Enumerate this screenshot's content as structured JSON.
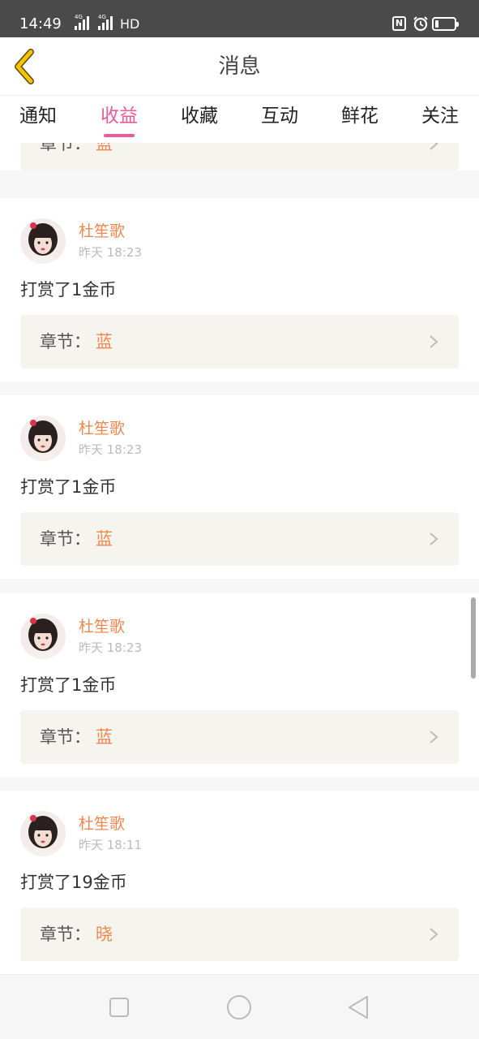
{
  "status_bar": {
    "time": "14:49",
    "network_1": "4G",
    "network_2": "4G",
    "hd": "HD",
    "battery_level": 0.2,
    "icons": [
      "signal-icon",
      "signal-icon",
      "nfc-icon",
      "alarm-icon",
      "battery-icon"
    ]
  },
  "header": {
    "title": "消息",
    "back_icon": "back-arrow-icon",
    "back_color": "#f5c400"
  },
  "tabs": [
    {
      "label": "通知",
      "active": false
    },
    {
      "label": "收益",
      "active": true
    },
    {
      "label": "收藏",
      "active": false
    },
    {
      "label": "互动",
      "active": false
    },
    {
      "label": "鲜花",
      "active": false
    },
    {
      "label": "关注",
      "active": false
    }
  ],
  "colors": {
    "accent": "#e85b98",
    "name": "#f0874f",
    "chapter_bg": "#f5f4ee"
  },
  "chapter_label": "章节：",
  "partial_card": {
    "chapter_label": "章节：",
    "chapter_value": "蓝"
  },
  "messages": [
    {
      "user": "杜笙歌",
      "time": "昨天 18:23",
      "text": "打赏了1金币",
      "chapter": "蓝"
    },
    {
      "user": "杜笙歌",
      "time": "昨天 18:23",
      "text": "打赏了1金币",
      "chapter": "蓝"
    },
    {
      "user": "杜笙歌",
      "time": "昨天 18:23",
      "text": "打赏了1金币",
      "chapter": "蓝"
    },
    {
      "user": "杜笙歌",
      "time": "昨天 18:11",
      "text": "打赏了19金币",
      "chapter": "晓"
    }
  ],
  "nav_bar": {
    "icons": [
      "recent-apps-icon",
      "home-icon",
      "back-icon"
    ]
  }
}
